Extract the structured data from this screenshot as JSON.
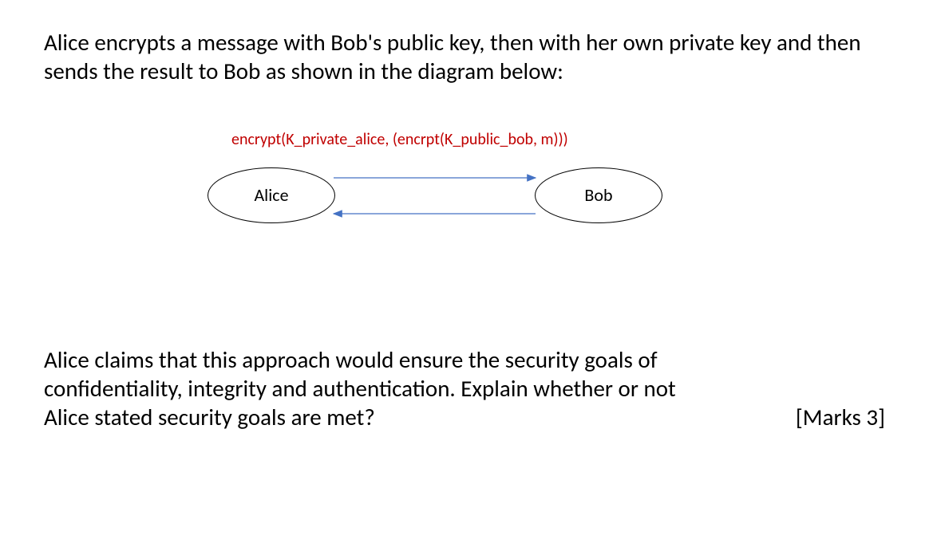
{
  "intro": "Alice encrypts a message with Bob's public key, then with her own private key and then sends the result to Bob as shown in the diagram below:",
  "diagram": {
    "encrypt_label": "encrypt(K_private_alice, (encrpt(K_public_bob, m)))",
    "node_left": "Alice",
    "node_right": "Bob"
  },
  "question": {
    "line1": "Alice claims that this approach would ensure the security goals of",
    "line2": "confidentiality, integrity and authentication. Explain whether or not",
    "line3": "Alice stated security goals are met?",
    "marks": "[Marks 3]"
  }
}
